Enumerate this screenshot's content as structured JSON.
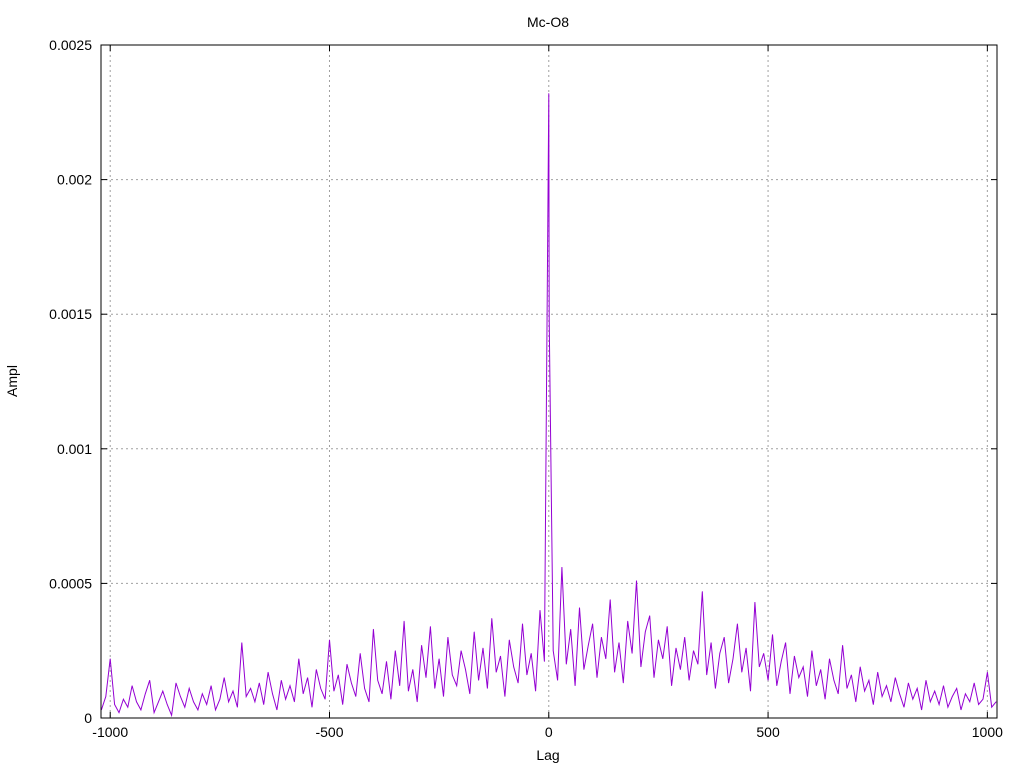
{
  "chart_data": {
    "type": "line",
    "title": "Mc-O8",
    "xlabel": "Lag",
    "ylabel": "Ampl",
    "xlim": [
      -1021,
      1022
    ],
    "ylim": [
      0,
      0.0025
    ],
    "grid": true,
    "x_ticks": [
      -1000,
      -500,
      0,
      500,
      1000
    ],
    "x_tick_labels": [
      "-1000",
      "-500",
      "0",
      "500",
      "1000"
    ],
    "y_ticks": [
      0,
      0.0005,
      0.001,
      0.0015,
      0.002,
      0.0025
    ],
    "y_tick_labels": [
      "0",
      "0.0005",
      "0.001",
      "0.0015",
      "0.002",
      "0.0025"
    ],
    "series": [
      {
        "name": "Mc-O8",
        "color": "#9400d3",
        "x_start": -1020,
        "x_step": 10,
        "values_scale": 1e-05,
        "values": [
          3,
          8,
          22,
          5,
          2,
          7,
          4,
          12,
          6,
          3,
          9,
          14,
          2,
          6,
          10,
          5,
          1,
          13,
          8,
          4,
          11,
          6,
          3,
          9,
          5,
          12,
          3,
          7,
          15,
          6,
          10,
          4,
          28,
          8,
          11,
          6,
          13,
          5,
          17,
          9,
          3,
          14,
          7,
          12,
          6,
          22,
          9,
          15,
          4,
          18,
          11,
          7,
          29,
          10,
          16,
          5,
          20,
          13,
          8,
          24,
          11,
          6,
          33,
          14,
          9,
          21,
          7,
          25,
          12,
          36,
          10,
          18,
          6,
          27,
          15,
          34,
          11,
          22,
          8,
          30,
          16,
          12,
          25,
          18,
          9,
          32,
          14,
          26,
          11,
          37,
          17,
          23,
          8,
          29,
          19,
          13,
          35,
          16,
          24,
          10,
          40,
          21,
          232,
          25,
          14,
          56,
          20,
          33,
          12,
          41,
          18,
          27,
          35,
          15,
          30,
          22,
          44,
          17,
          28,
          13,
          36,
          24,
          51,
          19,
          32,
          38,
          15,
          29,
          22,
          34,
          12,
          26,
          18,
          30,
          14,
          25,
          20,
          47,
          16,
          28,
          11,
          24,
          30,
          13,
          22,
          35,
          17,
          26,
          10,
          43,
          19,
          24,
          14,
          31,
          12,
          21,
          28,
          9,
          23,
          15,
          19,
          8,
          25,
          12,
          18,
          7,
          22,
          14,
          9,
          27,
          11,
          16,
          6,
          19,
          10,
          14,
          5,
          17,
          8,
          12,
          6,
          15,
          9,
          4,
          13,
          7,
          11,
          3,
          14,
          6,
          10,
          5,
          12,
          4,
          8,
          11,
          3,
          9,
          6,
          13,
          5,
          7,
          17,
          4,
          6
        ],
        "extra_points": [
          {
            "x": 1,
            "y": 148
          }
        ]
      }
    ]
  }
}
